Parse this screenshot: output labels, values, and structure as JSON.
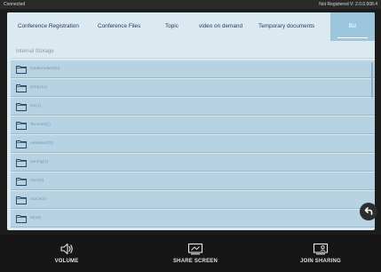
{
  "status": {
    "left": "Connected",
    "right": "Not Registered  V: 2.0.0.508.4"
  },
  "tabs": [
    {
      "label": "Conference Registration",
      "active": false
    },
    {
      "label": "Conference Files",
      "active": false
    },
    {
      "label": "Topic",
      "active": false
    },
    {
      "label": "video on demand",
      "active": false
    },
    {
      "label": "Temporary documents",
      "active": false
    },
    {
      "label": "Biz",
      "active": true
    }
  ],
  "storage_label": "Internal Storage",
  "folders": [
    {
      "name": "tcadtemdulut(0)"
    },
    {
      "name": "temp(11)"
    },
    {
      "name": "zte(1)"
    },
    {
      "name": "Tencent(1)"
    },
    {
      "name": "netease(33)"
    },
    {
      "name": "ventrig(1)"
    },
    {
      "name": "Vivo(0)"
    },
    {
      "name": "rtrace(0)"
    },
    {
      "name": "ttt(19)"
    }
  ],
  "bottom": {
    "volume": "VOLUME",
    "share_screen": "SHARE SCREEN",
    "join_sharing": "JOIN SHARING"
  },
  "icons": {
    "folder": "folder-icon",
    "back": "back-arrow-icon",
    "volume": "speaker-icon",
    "share": "screen-share-icon",
    "join": "join-sharing-icon"
  },
  "colors": {
    "tab_active": "#9cc6de",
    "row_bg": "#b6d2e3",
    "bottom_bar": "#161616"
  }
}
